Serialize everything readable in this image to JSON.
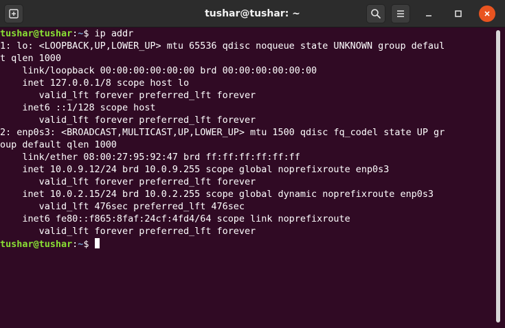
{
  "window": {
    "title": "tushar@tushar: ~"
  },
  "prompt": {
    "user_host": "tushar@tushar",
    "separator": ":",
    "path": "~",
    "symbol": "$ "
  },
  "terminal": {
    "command": "ip addr",
    "output": [
      "1: lo: <LOOPBACK,UP,LOWER_UP> mtu 65536 qdisc noqueue state UNKNOWN group defaul",
      "t qlen 1000",
      "    link/loopback 00:00:00:00:00:00 brd 00:00:00:00:00:00",
      "    inet 127.0.0.1/8 scope host lo",
      "       valid_lft forever preferred_lft forever",
      "    inet6 ::1/128 scope host",
      "       valid_lft forever preferred_lft forever",
      "2: enp0s3: <BROADCAST,MULTICAST,UP,LOWER_UP> mtu 1500 qdisc fq_codel state UP gr",
      "oup default qlen 1000",
      "    link/ether 08:00:27:95:92:47 brd ff:ff:ff:ff:ff:ff",
      "    inet 10.0.9.12/24 brd 10.0.9.255 scope global noprefixroute enp0s3",
      "       valid_lft forever preferred_lft forever",
      "    inet 10.0.2.15/24 brd 10.0.2.255 scope global dynamic noprefixroute enp0s3",
      "       valid_lft 476sec preferred_lft 476sec",
      "    inet6 fe80::f865:8faf:24cf:4fd4/64 scope link noprefixroute",
      "       valid_lft forever preferred_lft forever"
    ]
  },
  "icons": {
    "new_tab": "new-tab-icon",
    "search": "search-icon",
    "menu": "hamburger-menu-icon",
    "minimize": "minimize-icon",
    "maximize": "maximize-icon",
    "close": "close-icon"
  },
  "colors": {
    "background": "#300a24",
    "titlebar": "#2c2c2c",
    "prompt_user": "#8ae234",
    "prompt_path": "#729fcf",
    "close_button": "#e95420"
  }
}
